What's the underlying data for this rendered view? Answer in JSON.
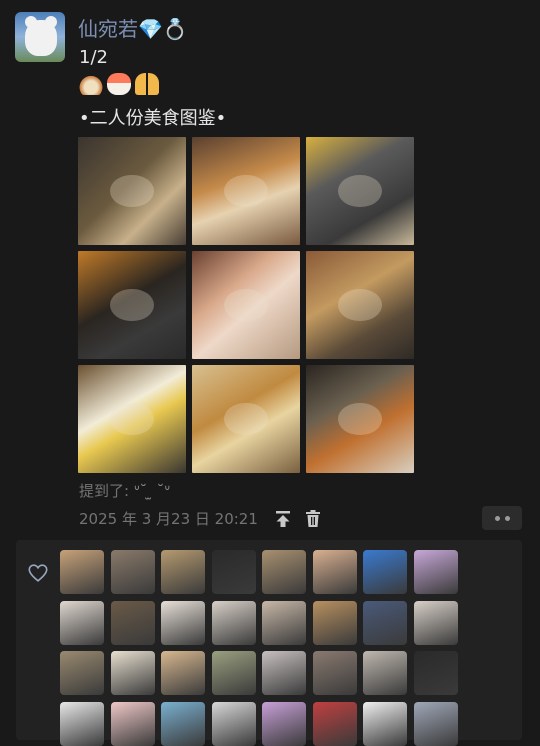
{
  "post": {
    "author": "仙宛若💎💍",
    "page_indicator": "1/2",
    "emojis": [
      "noodle-bowl-emoji",
      "sushi-emoji",
      "couple-emoji"
    ],
    "caption": "•二人份美食图鉴•",
    "photos": [
      {
        "name": "photo-hotpot-table",
        "bg": "linear-gradient(135deg,#3a3530,#6b5a3e 45%,#c7b08a 70%,#4a3f35)"
      },
      {
        "name": "photo-dishes-table",
        "bg": "linear-gradient(160deg,#5a4030,#c58a4a 40%,#e6d2b0 60%,#7a5a40)"
      },
      {
        "name": "photo-bowls-dark-table",
        "bg": "linear-gradient(150deg,#d8b040,#5a5a5a 35%,#3a3a3a 70%,#c9b99a)"
      },
      {
        "name": "photo-sushi-grill",
        "bg": "linear-gradient(150deg,#c07a28,#2a2520 45%,#3a3a3a 70%,#2a2a2a)"
      },
      {
        "name": "photo-couple-selfie",
        "bg": "linear-gradient(140deg,#6a4030,#d9a88a 35%,#eed8c8 55%,#b59a80)"
      },
      {
        "name": "photo-dinner-spread",
        "bg": "linear-gradient(150deg,#8a5a38,#c39a60 40%,#5a4a38 70%,#2e2a26)"
      },
      {
        "name": "photo-yellow-plate",
        "bg": "linear-gradient(150deg,#6a5030,#f2ecd8 40%,#e8c850 55%,#3a3632)"
      },
      {
        "name": "photo-fried-food-boxes",
        "bg": "linear-gradient(150deg,#d8c090,#c08a40 40%,#e8d4a0 60%,#7a6040)"
      },
      {
        "name": "photo-noodle-bowls",
        "bg": "linear-gradient(150deg,#2a2520,#6a6050 35%,#c07030 60%,#d8cfc0)"
      }
    ],
    "mention_prefix": "提到了: ",
    "mention_name": "ᐡ˘ ̫ ˘ᐡ",
    "timestamp": "2025 年 3 月23 日 20:21"
  },
  "likers": [
    "#c7a27a",
    "#8a7a6a",
    "#b59a70",
    "#2a2a2a",
    "#a89070",
    "#d9b090",
    "#3a7ad0",
    "#c8a8d8",
    "#e0d8d0",
    "#6a5a48",
    "#e8e0d8",
    "#d8d0c8",
    "#c8b8a8",
    "#b89060",
    "#4a5a7a",
    "#d8d0c8",
    "#9a8a70",
    "#e8e0d0",
    "#d8b890",
    "#9aa080",
    "#c8c0c0",
    "#8a7a70",
    "#c0b8b0",
    "#2a2a2a",
    "#e8e8e8",
    "#f0c8c8",
    "#7ab0d0",
    "#d8d8d8",
    "#c8a0d8",
    "#c04040",
    "#f0f0f0",
    "#a0a8b8"
  ],
  "colors": {
    "name": "#7d90b3",
    "background": "#191919",
    "meta": "#747474"
  }
}
